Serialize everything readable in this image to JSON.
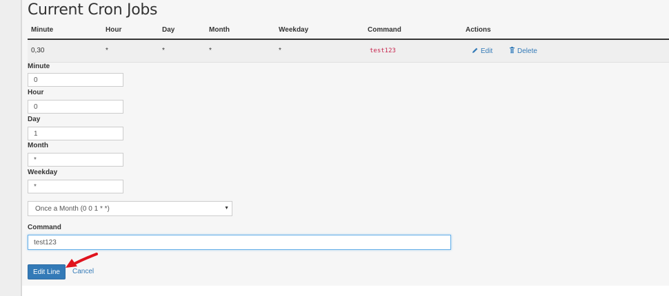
{
  "page_title": "Current Cron Jobs",
  "table": {
    "headers": [
      "Minute",
      "Hour",
      "Day",
      "Month",
      "Weekday",
      "Command",
      "Actions"
    ],
    "row": {
      "minute": "0,30",
      "hour": "*",
      "day": "*",
      "month": "*",
      "weekday": "*",
      "command": "test123",
      "edit_label": "Edit",
      "delete_label": "Delete"
    }
  },
  "form": {
    "minute": {
      "label": "Minute",
      "value": "0"
    },
    "hour": {
      "label": "Hour",
      "value": "0"
    },
    "day": {
      "label": "Day",
      "value": "1"
    },
    "month": {
      "label": "Month",
      "value": "*"
    },
    "weekday": {
      "label": "Weekday",
      "value": "*"
    },
    "common_settings": {
      "selected": "Once a Month (0 0 1 * *)"
    },
    "command": {
      "label": "Command",
      "value": "test123"
    },
    "submit_label": "Edit Line",
    "cancel_label": "Cancel"
  },
  "colors": {
    "accent": "#337ab7",
    "code": "#c7254e",
    "annotation_arrow": "#e0141e"
  },
  "icons": {
    "edit": "pencil-icon",
    "delete": "trash-icon",
    "select_caret": "caret-down-icon",
    "annotation": "red-arrow-icon"
  }
}
